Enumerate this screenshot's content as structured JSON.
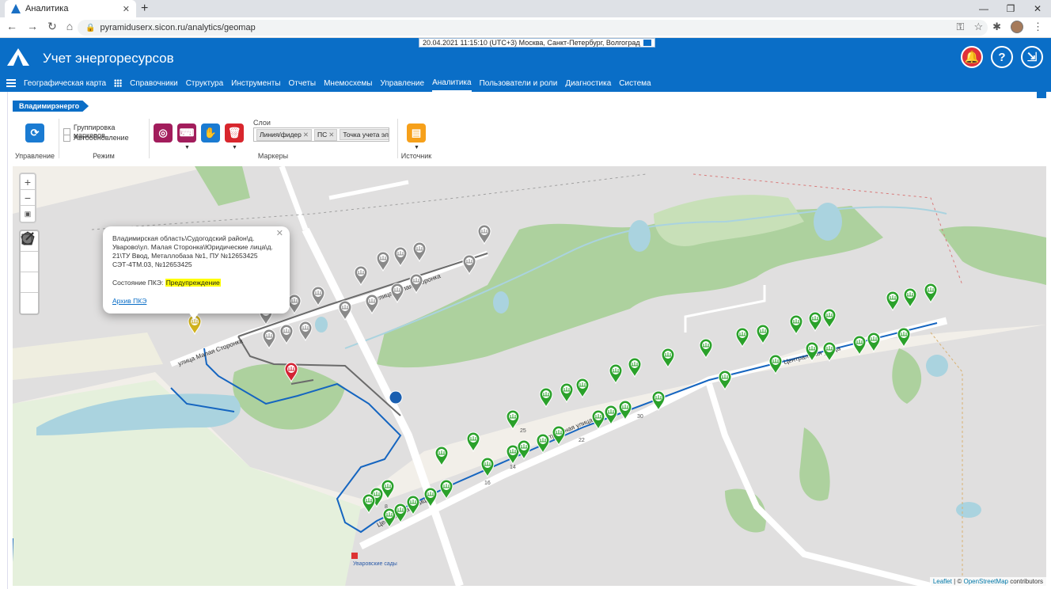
{
  "browser": {
    "tab_title": "Аналитика",
    "url": "pyramiduserx.sicon.ru/analytics/geomap"
  },
  "header": {
    "datetime": "20.04.2021 11:15:10 (UTC+3) Москва, Санкт-Петербург, Волгоград",
    "app_title": "Учет энергоресурсов"
  },
  "menu": [
    "Географическая карта",
    "Справочники",
    "Структура",
    "Инструменты",
    "Отчеты",
    "Мнемосхемы",
    "Управление",
    "Аналитика",
    "Пользователи и роли",
    "Диагностика",
    "Система"
  ],
  "breadcrumb": "Владимирэнерго",
  "toolbar": {
    "group_control": "Управление",
    "group_mode": "Режим",
    "group_markers": "Маркеры",
    "group_source": "Источник",
    "chk_grouping": "Группировка маркеров",
    "chk_autorefresh": "Автообновление",
    "layers_title": "Слои",
    "layers": [
      "Линия/фидер",
      "ПС",
      "Точка учета эл"
    ]
  },
  "popup": {
    "address": "Владимирская область\\Судогодский район\\д. Уварово\\ул. Малая Сторонка\\Юридические лица\\д. 21\\ТУ Ввод, Металлобаза №1, ПУ №12653425 СЭТ-4ТМ.03, №12653425",
    "state_label": "Состояние ПКЭ:",
    "state_value": "Предупреждение",
    "archive_link": "Архив ПКЭ"
  },
  "map": {
    "street_labels": [
      "улица Малая Сторонка",
      "улица Малая Сторонка",
      "Центральная улица",
      "Центральная улица",
      "Центральная улица"
    ],
    "house_numbers": [
      "25",
      "22",
      "30",
      "16",
      "14",
      "8"
    ],
    "place_label": "Уваровские сады"
  },
  "attribution": {
    "leaflet": "Leaflet",
    "sep": " | © ",
    "osm": "OpenStreetMap",
    "tail": " contributors"
  },
  "colors": {
    "brand": "#0a6ec7",
    "marker_ok": "#2aa12a",
    "marker_inactive": "#8a8a8a",
    "marker_warning": "#d1b21c",
    "marker_alarm": "#d32233",
    "feeder_line": "#1565c0"
  }
}
